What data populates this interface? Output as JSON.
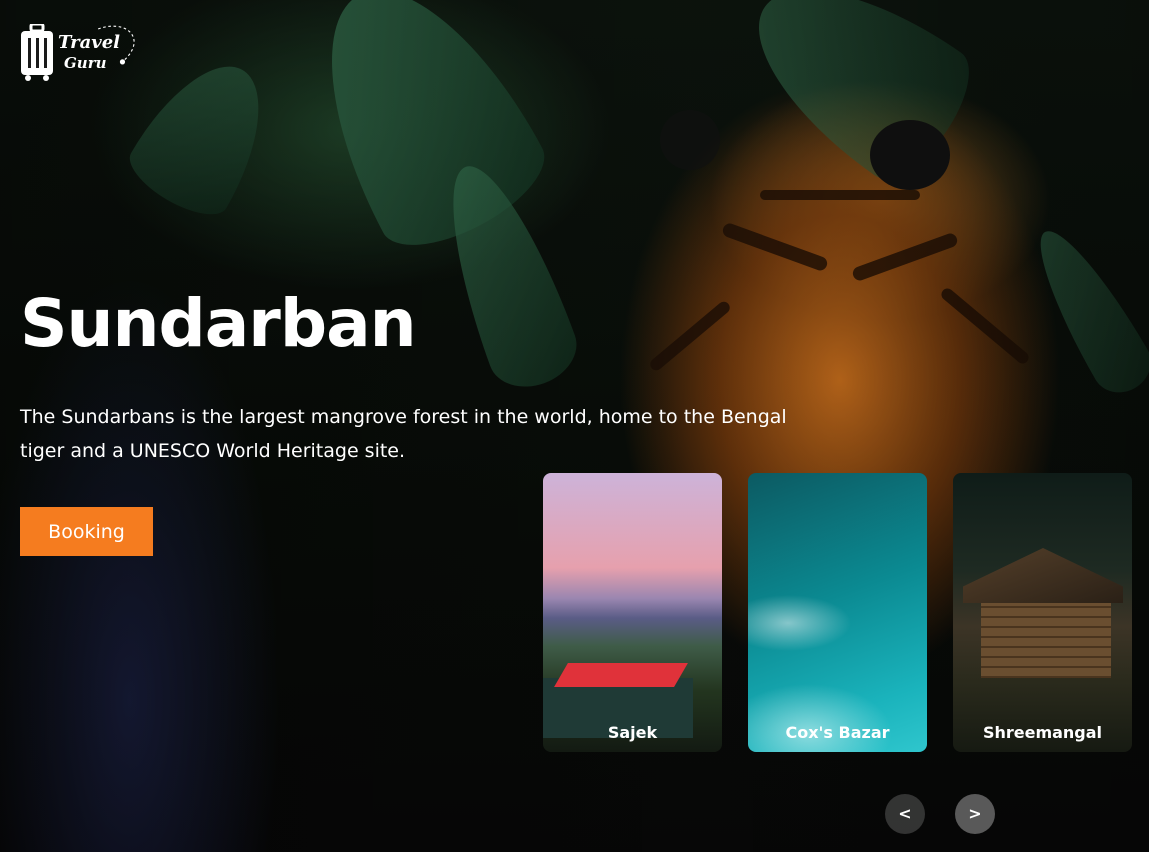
{
  "brand": {
    "name_line1": "Travel",
    "name_line2": "Guru",
    "logo_icon": "suitcase-icon"
  },
  "hero": {
    "title": "Sundarban",
    "description": "The Sundarbans is the largest mangrove forest in the world, home to the Bengal tiger and a UNESCO World Heritage site.",
    "booking_label": "Booking",
    "background": "tiger-in-jungle-photo"
  },
  "destinations": [
    {
      "name": "Sajek",
      "image": "hill-view-photo"
    },
    {
      "name": "Cox's Bazar",
      "image": "ocean-beach-photo"
    },
    {
      "name": "Shreemangal",
      "image": "forest-cabin-photo"
    }
  ],
  "carousel": {
    "prev_label": "<",
    "next_label": ">"
  },
  "colors": {
    "accent": "#f57c1f",
    "text": "#ffffff"
  }
}
